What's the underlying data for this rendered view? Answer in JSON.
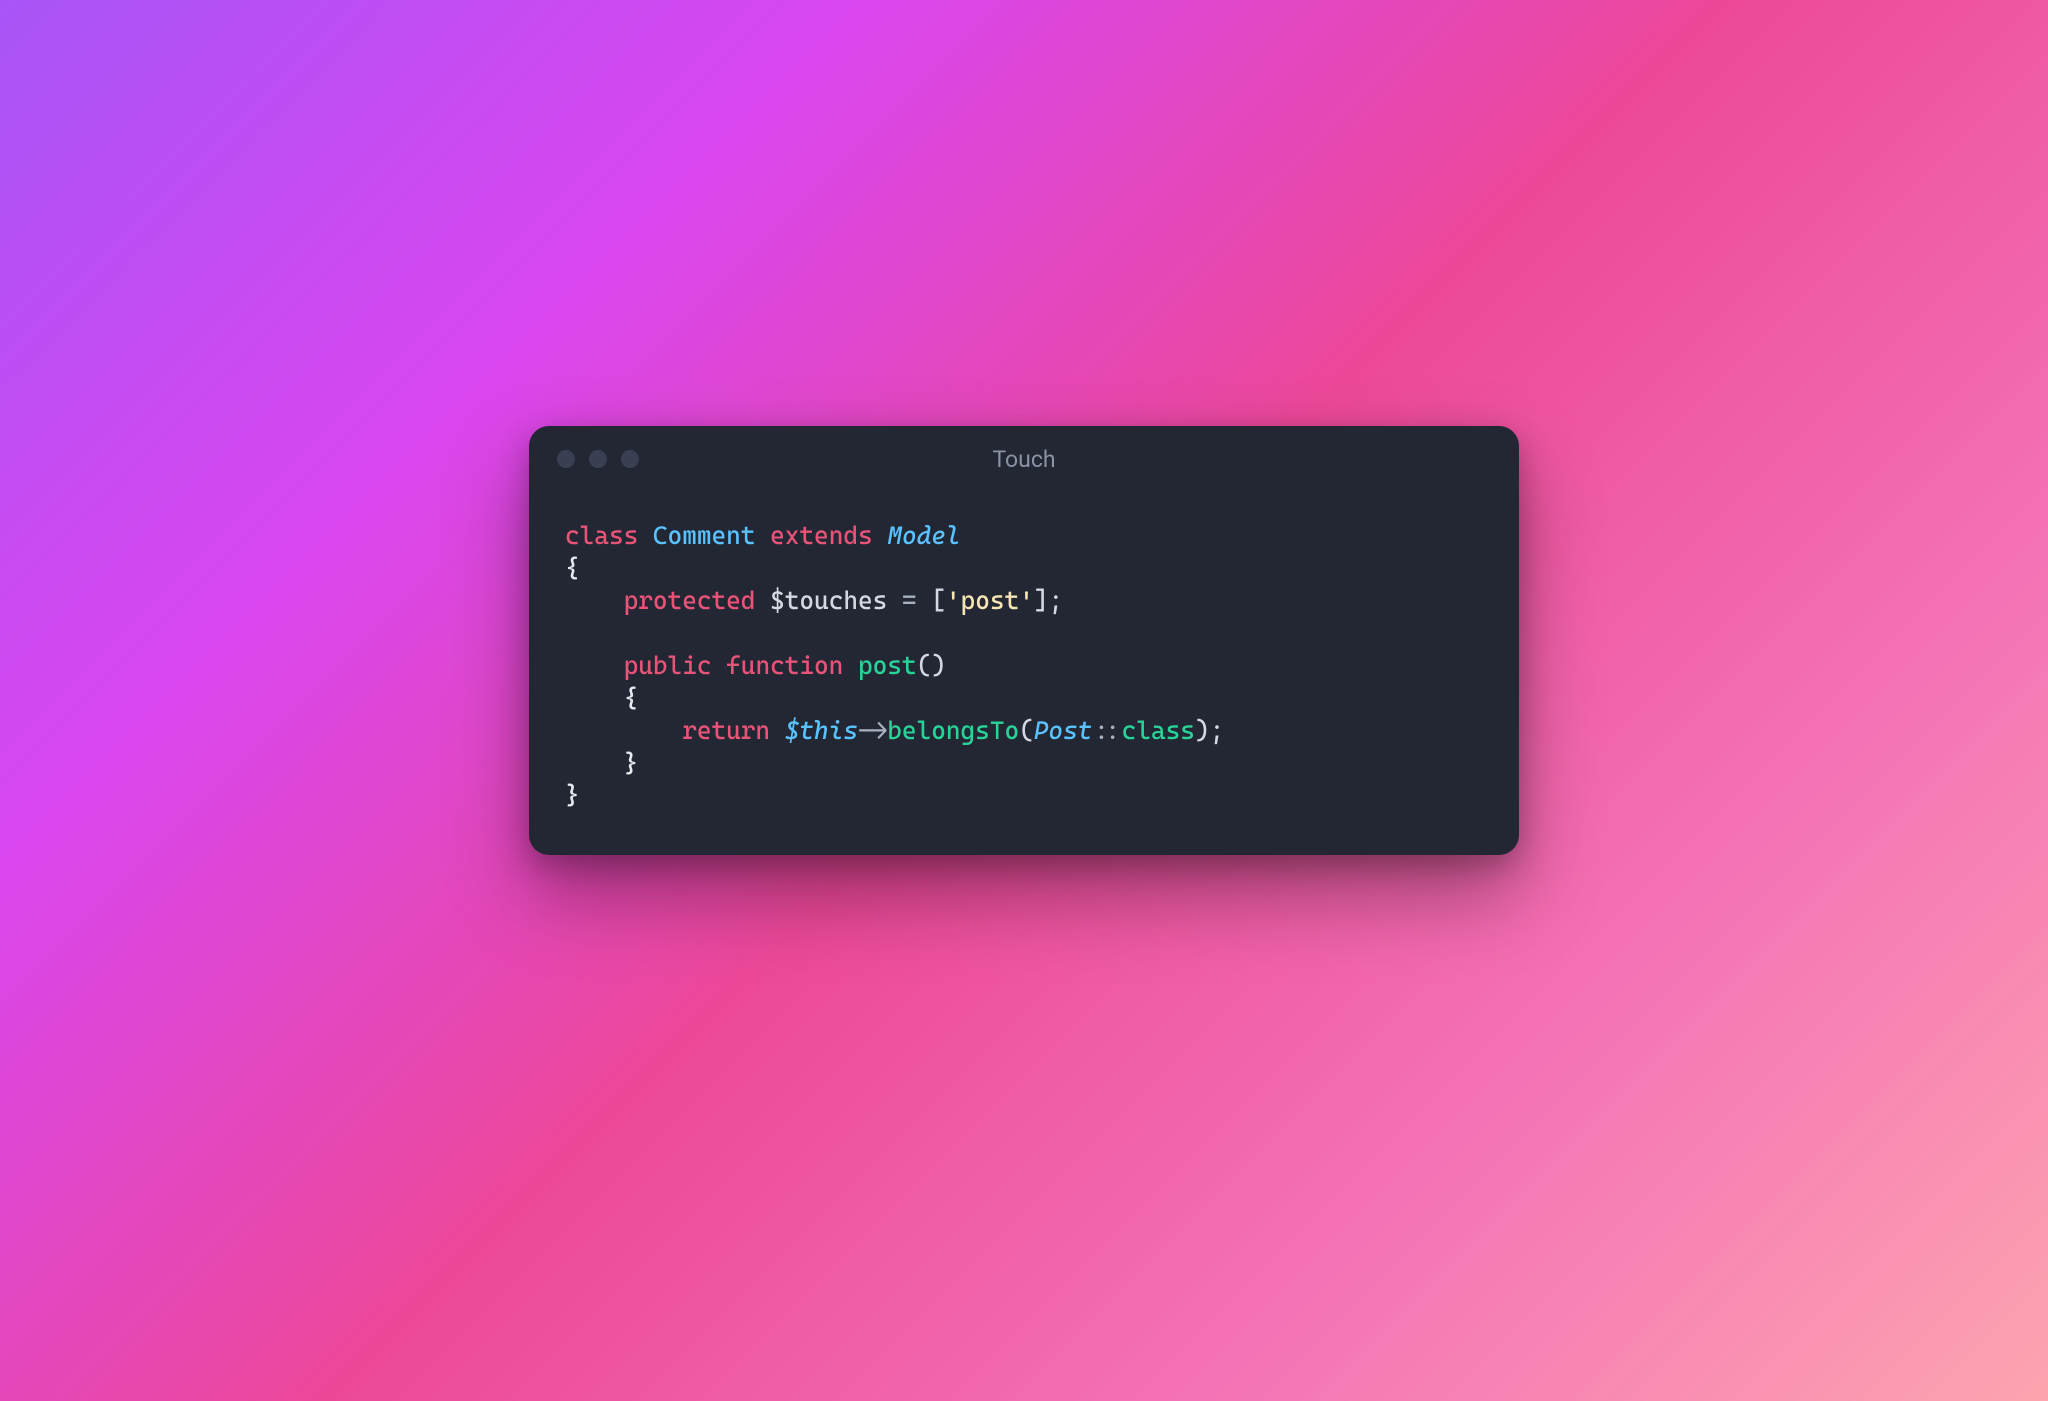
{
  "window": {
    "title": "Touch"
  },
  "code": {
    "line1": {
      "class_kw": "class",
      "class_name": "Comment",
      "extends_kw": "extends",
      "parent": "Model"
    },
    "line2": {
      "brace": "{"
    },
    "line3": {
      "modifier": "protected",
      "var": "$touches",
      "eq": " = ",
      "bracket_open": "[",
      "quote1": "'",
      "str": "post",
      "quote2": "'",
      "bracket_close": "]",
      "semi": ";"
    },
    "line5": {
      "public": "public",
      "function": "function",
      "name": "post",
      "parens": "()"
    },
    "line6": {
      "brace": "{"
    },
    "line7": {
      "return": "return",
      "this": "$this",
      "arrow": "->",
      "method": "belongsTo",
      "paren_open": "(",
      "post_class": "Post",
      "scope": "::",
      "class_word": "class",
      "paren_close": ")",
      "semi": ";"
    },
    "line8": {
      "brace": "}"
    },
    "line9": {
      "brace": "}"
    }
  }
}
